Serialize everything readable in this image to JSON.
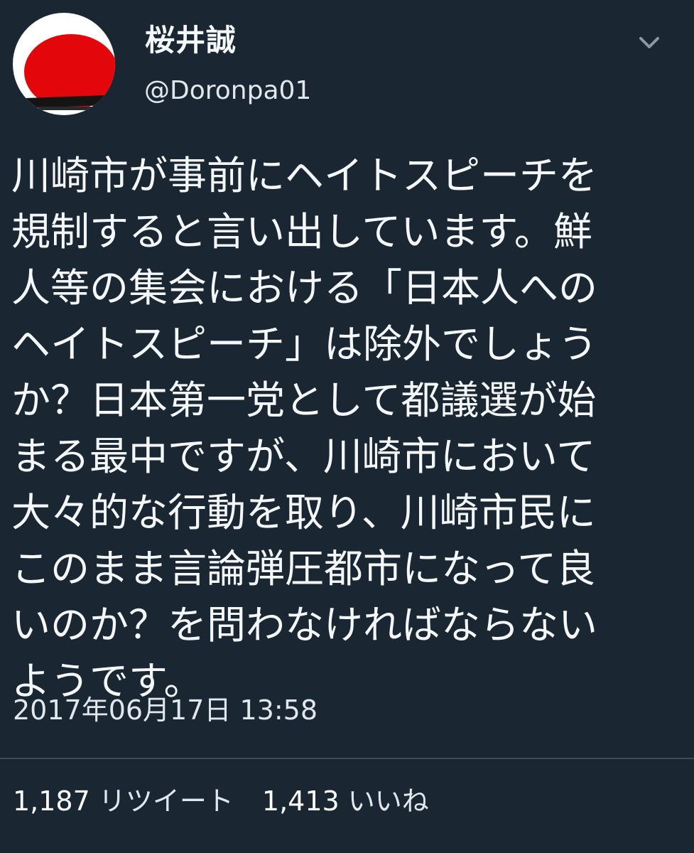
{
  "user": {
    "display_name": "桜井誠",
    "handle": "@Doronpa01",
    "avatar_icon": "avatar-rising-sun-icon",
    "menu_icon": "chevron-down-icon"
  },
  "tweet": {
    "text": "川崎市が事前にヘイトスピーチを\n規制すると言い出しています。鮮\n人等の集会における「日本人への\nヘイトスピーチ」は除外でしょう\nか？日本第一党として都議選が始\nまる最中ですが、川崎市において\n大々的な行動を取り、川崎市民に\nこのまま言論弾圧都市になって良\nいのか？を問わなければならない\nようです。",
    "timestamp": "2017年06月17日 13:58"
  },
  "stats": {
    "retweet_count": "1,187",
    "retweet_label": "リツイート",
    "like_count": "1,413",
    "like_label": "いいね"
  },
  "colors": {
    "background": "#1b2633",
    "text": "#f5f8fa",
    "secondary_text": "#e1e8ed",
    "divider": "#3d4a58",
    "avatar_red": "#e3070b"
  }
}
